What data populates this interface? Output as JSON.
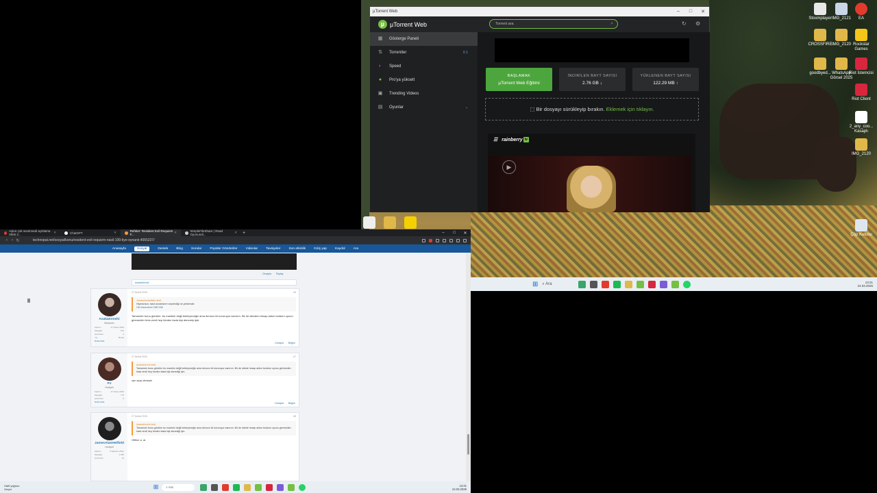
{
  "desktop": {
    "icons": [
      {
        "label": "Stoxmplayer",
        "color": "#e8e8e8"
      },
      {
        "label": "IMG_2121",
        "color": "#c9d6e8"
      },
      {
        "label": "EA",
        "color": "#e23b2e"
      },
      {
        "label": "CROSSFIRE",
        "color": "#e0b84a"
      },
      {
        "label": "IMG_2120",
        "color": "#e0b84a"
      },
      {
        "label": "Rockstar Games",
        "color": "#f5c518"
      },
      {
        "label": "goodbyed...",
        "color": "#e0b84a"
      },
      {
        "label": "WhatsApp Görsel 2025",
        "color": "#e0b84a"
      },
      {
        "label": "Riot İstemcisi",
        "color": "#d7263d"
      },
      {
        "label": "Riot Client",
        "color": "#d7263d"
      },
      {
        "label": "2_any_coo... Kasaplı",
        "color": "#ffffff"
      },
      {
        "label": "IMG_2120",
        "color": "#e0b84a"
      },
      {
        "label": "Çöp Kutusu",
        "color": "#dde6ef"
      }
    ],
    "taskbar_right": {
      "search": "Ara",
      "time": "13:21",
      "date": "24.03.2026"
    }
  },
  "utorrent": {
    "window_title": "µTorrent Web",
    "brand": "µTorrent Web",
    "search_placeholder": "Torrent ara",
    "nav": [
      {
        "label": "Gösterge Paneli",
        "icon": "dashboard-icon",
        "active": true
      },
      {
        "label": "Torrentler",
        "icon": "torrents-icon",
        "counts": "0 1"
      },
      {
        "label": "Speed",
        "icon": "speed-icon"
      },
      {
        "label": "Pro'ya yükselt",
        "icon": "pro-icon"
      },
      {
        "label": "Trending Videos",
        "icon": "video-icon"
      },
      {
        "label": "Oyunlar",
        "icon": "games-icon"
      }
    ],
    "cards": {
      "start_title": "BAŞLAMAK",
      "start_sub": "µTorrent Web Eğitimi",
      "down_title": "İNDİRİLEN BAYT SAYISI",
      "down_value": "2.76 GB ↓",
      "up_title": "YÜKLENEN BAYT SAYISI",
      "up_value": "122.29 MB ↑"
    },
    "drop_text": "Bir dosyayı sürükleyip bırakın.",
    "drop_link": "Eklemek için tıklayın.",
    "rainberry_brand": "rainberry",
    "rainberry_tv": "tv"
  },
  "browser": {
    "tabs": [
      {
        "label": "Aşkın çok sevimnedi açıklama 0505 2...",
        "color": "#e23b2e",
        "active": false
      },
      {
        "label": "ChatGPT",
        "color": "#ffffff",
        "active": false
      },
      {
        "label": "Rehber: Resident Evil Requiem F...",
        "color": "#f29b3a",
        "active": true
      },
      {
        "label": "SimpleFileShare | Read Oyunundi...",
        "color": "#cccccc",
        "active": false
      }
    ],
    "url": "technopat.net/sosyal/konu/resident-evil-requiem-nasil-100-tiye-oynanir.4055227/",
    "nav_items": [
      "Anasayfa",
      "Sosyal",
      "Destek",
      "Blog",
      "Sorular",
      "Popüler Gönderiler",
      "Videolar",
      "Tavsiyeler",
      "Son etkinlik",
      "Giriş yap",
      "Kaydol",
      "Ara"
    ],
    "top_actions": [
      "Cevapla",
      "Paylaş"
    ],
    "tag": "AsakaKenshi",
    "posts": [
      {
        "date": "27 Şubat 2026",
        "num": "#6",
        "user": "AsakaKenshi",
        "role": "Müdavim",
        "stats": [
          [
            "Katılım",
            "27 Nisan 2016"
          ],
          [
            "Mesajlar",
            "676"
          ],
          [
            "Çözümler",
            "6"
          ],
          [
            "Yer",
            "Bursa"
          ]
        ],
        "quote_head": "Jamesclanhetfield dedi:",
        "quote": "Hiyerarsizo; takvi anzartarım veymediği ne yöntemdir.",
        "quote_link": "Obi Kanenbohi 2867436",
        "text": "Tamamdır bunu gördüm. bu mantıklı değil bekleyeceğiz ama denovo ile koruruyor sanırım. Bir de sitedem hesap aldım buldum oyunu giremedim fırıla verdi hep binden fazla kişi denemiş işte.",
        "actions": [
          "Cevapla",
          "Beğen"
        ]
      },
      {
        "date": "27 Şubat 2026",
        "num": "#7",
        "user": "PJ",
        "role": "Hediyeli",
        "stats": [
          [
            "Katılım",
            "17 Nisan 2022"
          ],
          [
            "Mesajlar",
            "770"
          ],
          [
            "Çözümler",
            "6"
          ]
        ],
        "quote_head": "AsakaKenshi dedi:",
        "quote": "Tamamdır bunu gördüm bu mantıklı değil bekleyeceğiz ama denovo ile koruruyor sanırım. Bir de sitede hesap aldım buldum oyunu giremedim hata verdi hep binden fazla kişi denediği için.",
        "text": "vpn açıp deneyin",
        "actions": [
          "Cevapla",
          "Beğen"
        ]
      },
      {
        "date": "27 Şubat 2026",
        "num": "#8",
        "user": "JamesAlanHetfield",
        "role": "Hediyeli",
        "stats": [
          [
            "Katılım",
            "5 Ağustos 2021"
          ],
          [
            "Mesajlar",
            "1.255"
          ],
          [
            "Çözümler",
            "10"
          ]
        ],
        "quote_head": "AsakaKenshi dedi:",
        "quote": "Tamamdır bunu gördüm bu mantıklı değil bekleyeceğiz ama denovo ile koruruyor sanırım. Bir de sitede hesap aldım buldum oyunu giremedim hata verdi hep binden fazla kişi denediği için.",
        "text": "Offline a. al.",
        "actions": []
      }
    ],
    "more_label": "Daha fazla"
  },
  "taskbar_bottom": {
    "weather": "Hafif yağmur",
    "weather2": "Geçici",
    "search": "Ara",
    "time": "13:21",
    "date": "24.03.2026"
  }
}
